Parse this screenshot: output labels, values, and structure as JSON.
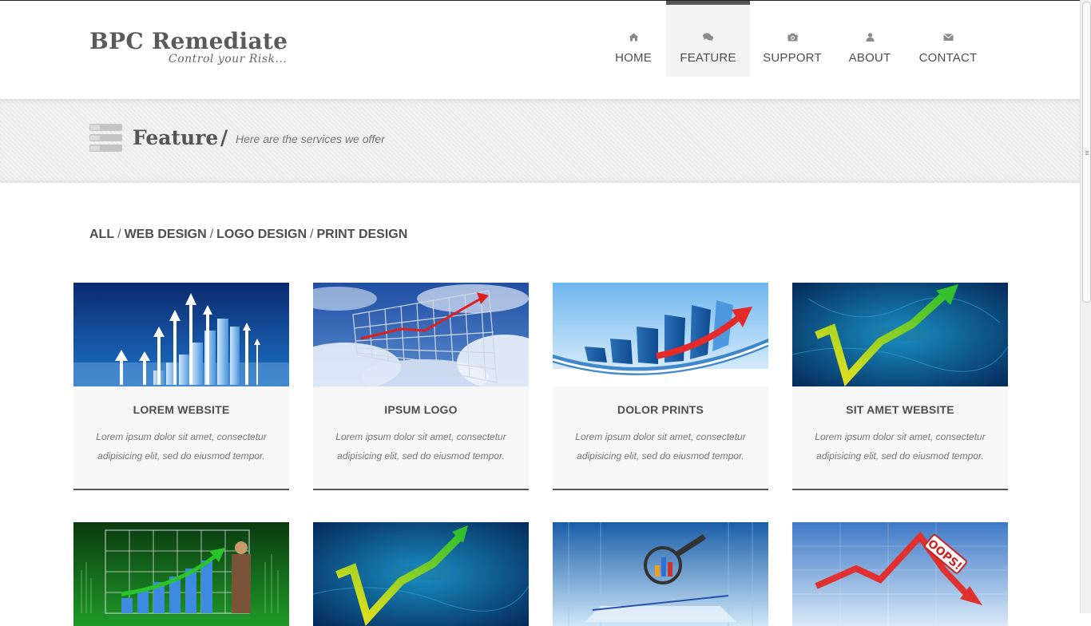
{
  "brand": {
    "title": "BPC Remediate",
    "tagline": "Control your Risk..."
  },
  "nav": [
    {
      "label": "HOME",
      "icon": "home-icon"
    },
    {
      "label": "FEATURE",
      "icon": "comments-icon",
      "active": true
    },
    {
      "label": "SUPPORT",
      "icon": "camera-icon"
    },
    {
      "label": "ABOUT",
      "icon": "user-icon"
    },
    {
      "label": "CONTACT",
      "icon": "envelope-icon"
    }
  ],
  "banner": {
    "title": "Feature",
    "slash": "/",
    "subtitle": "Here are the services we offer"
  },
  "filters": {
    "all": "ALL",
    "web": "WEB DESIGN",
    "logo": "LOGO DESIGN",
    "print": "PRINT DESIGN",
    "sep": "/"
  },
  "cards": [
    {
      "title": "LOREM WEBSITE",
      "desc": "Lorem ipsum dolor sit amet, consectetur adipisicing elit, sed do eiusmod tempor."
    },
    {
      "title": "IPSUM LOGO",
      "desc": "Lorem ipsum dolor sit amet, consectetur adipisicing elit, sed do eiusmod tempor."
    },
    {
      "title": "DOLOR PRINTS",
      "desc": "Lorem ipsum dolor sit amet, consectetur adipisicing elit, sed do eiusmod tempor."
    },
    {
      "title": "SIT AMET WEBSITE",
      "desc": "Lorem ipsum dolor sit amet, consectetur adipisicing elit, sed do eiusmod tempor."
    }
  ],
  "colors": {
    "text": "#555555",
    "accent": "#555555",
    "card_bg": "#f7f7f7",
    "banner_bg": "#efefef"
  }
}
